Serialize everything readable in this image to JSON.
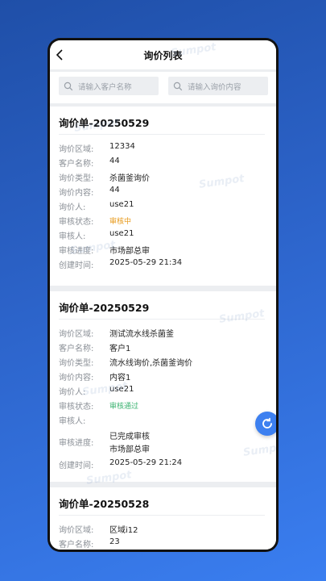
{
  "header": {
    "title": "询价列表"
  },
  "search": {
    "customer_placeholder": "请输入客户名称",
    "content_placeholder": "请输入询价内容"
  },
  "labels": {
    "region": "询价区域:",
    "customer": "客户名称:",
    "type": "询价类型:",
    "content": "询价内容:",
    "inquirer": "询价人:",
    "status": "审核状态:",
    "reviewer": "审核人:",
    "progress": "审核进度:",
    "created": "创建时间:"
  },
  "cards": [
    {
      "title": "询价单-20250529",
      "region": "12334",
      "customer": "44",
      "type": "杀菌釜询价",
      "content": "44",
      "inquirer": "use21",
      "status": "审核中",
      "reviewer": "use21",
      "progress": "市场部总审",
      "created": "2025-05-29 21:34"
    },
    {
      "title": "询价单-20250529",
      "region": "测试流水线杀菌釜",
      "customer": "客户1",
      "type": "流水线询价,杀菌釜询价",
      "content": "内容1",
      "inquirer": "use21",
      "status": "审核通过",
      "reviewer": "",
      "progress_line1": "已完成审核",
      "progress_line2": "市场部总审",
      "created": "2025-05-29 21:24"
    },
    {
      "title": "询价单-20250528",
      "region": "区域i12",
      "customer": "23"
    }
  ],
  "watermark": "Sumpot",
  "colors": {
    "accent": "#3d80f0",
    "pending": "#e79a1c",
    "approved": "#3cb371"
  }
}
